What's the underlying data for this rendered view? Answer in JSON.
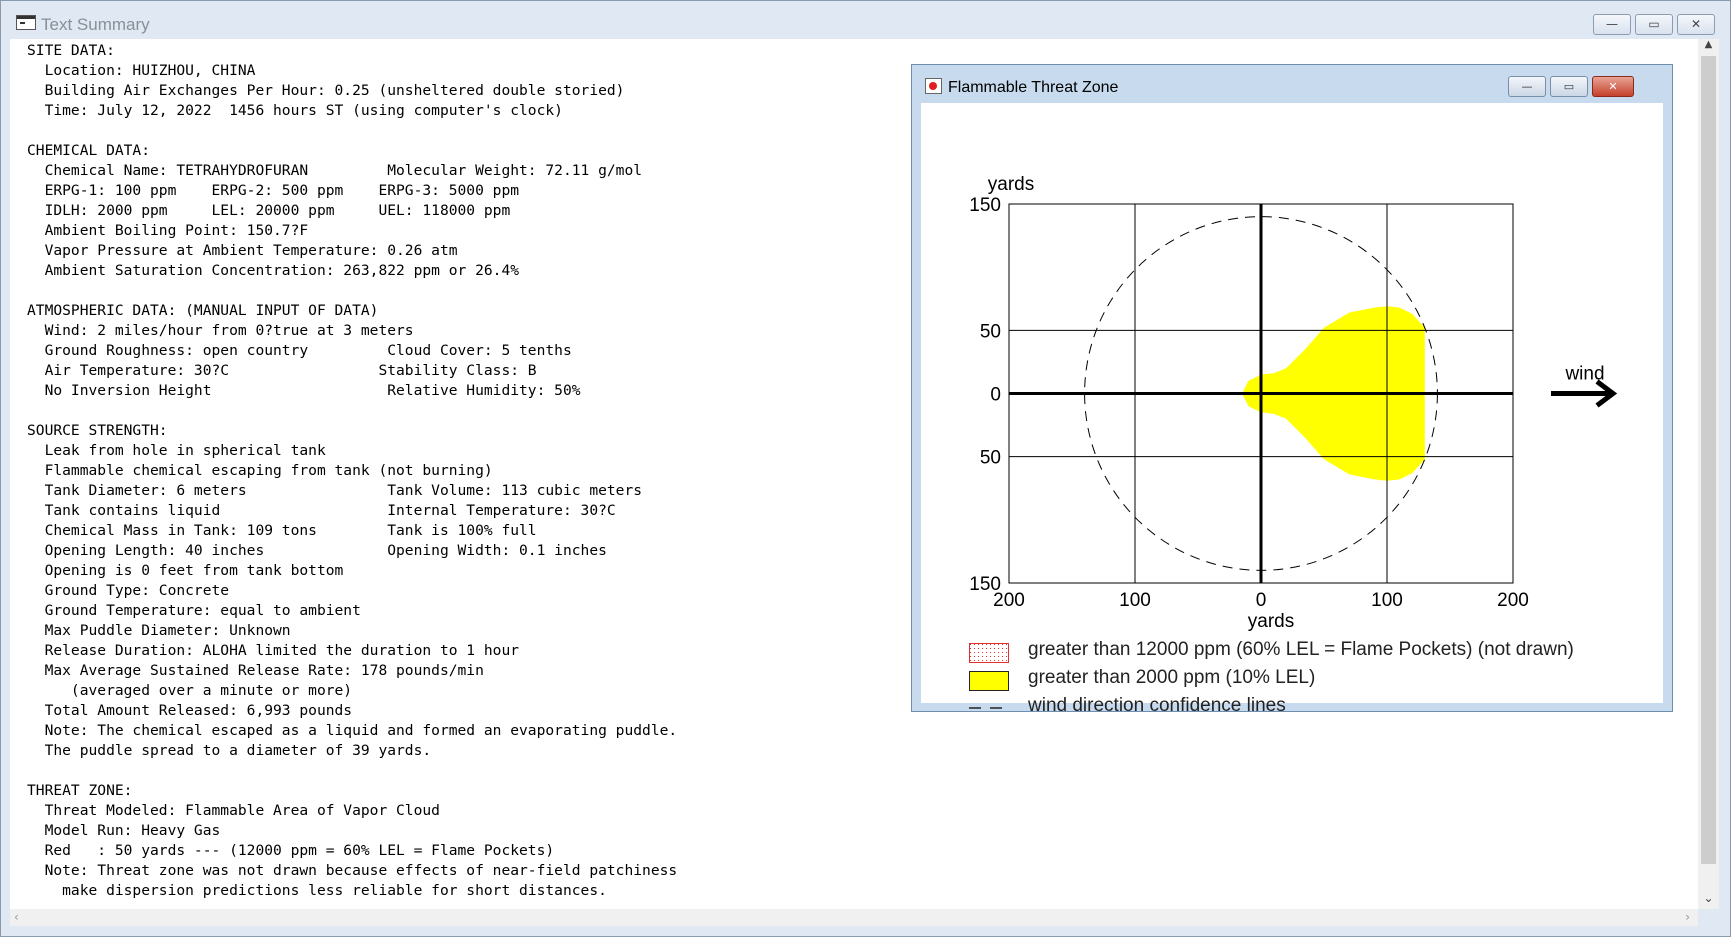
{
  "window": {
    "title": "Text Summary",
    "minimize": "—",
    "restore": "▭",
    "close": "✕"
  },
  "summary_lines": [
    "SITE DATA:",
    "  Location: HUIZHOU, CHINA",
    "  Building Air Exchanges Per Hour: 0.25 (unsheltered double storied)",
    "  Time: July 12, 2022  1456 hours ST (using computer's clock)",
    "",
    "CHEMICAL DATA:",
    "  Chemical Name: TETRAHYDROFURAN         Molecular Weight: 72.11 g/mol",
    "  ERPG-1: 100 ppm    ERPG-2: 500 ppm    ERPG-3: 5000 ppm",
    "  IDLH: 2000 ppm     LEL: 20000 ppm     UEL: 118000 ppm",
    "  Ambient Boiling Point: 150.7?F",
    "  Vapor Pressure at Ambient Temperature: 0.26 atm",
    "  Ambient Saturation Concentration: 263,822 ppm or 26.4%",
    "",
    "ATMOSPHERIC DATA: (MANUAL INPUT OF DATA)",
    "  Wind: 2 miles/hour from 0?true at 3 meters",
    "  Ground Roughness: open country         Cloud Cover: 5 tenths",
    "  Air Temperature: 30?C                 Stability Class: B",
    "  No Inversion Height                    Relative Humidity: 50%",
    "",
    "SOURCE STRENGTH:",
    "  Leak from hole in spherical tank",
    "  Flammable chemical escaping from tank (not burning)",
    "  Tank Diameter: 6 meters                Tank Volume: 113 cubic meters",
    "  Tank contains liquid                   Internal Temperature: 30?C",
    "  Chemical Mass in Tank: 109 tons        Tank is 100% full",
    "  Opening Length: 40 inches              Opening Width: 0.1 inches",
    "  Opening is 0 feet from tank bottom",
    "  Ground Type: Concrete",
    "  Ground Temperature: equal to ambient",
    "  Max Puddle Diameter: Unknown",
    "  Release Duration: ALOHA limited the duration to 1 hour",
    "  Max Average Sustained Release Rate: 178 pounds/min",
    "     (averaged over a minute or more)",
    "  Total Amount Released: 6,993 pounds",
    "  Note: The chemical escaped as a liquid and formed an evaporating puddle.",
    "  The puddle spread to a diameter of 39 yards.",
    "",
    "THREAT ZONE:",
    "  Threat Modeled: Flammable Area of Vapor Cloud",
    "  Model Run: Heavy Gas",
    "  Red   : 50 yards --- (12000 ppm = 60% LEL = Flame Pockets)",
    "  Note: Threat zone was not drawn because effects of near-field patchiness",
    "    make dispersion predictions less reliable for short distances."
  ],
  "threat_window": {
    "title": "Flammable Threat Zone",
    "minimize": "—",
    "restore": "▭",
    "close": "✕"
  },
  "plot": {
    "y_unit": "yards",
    "x_unit": "yards",
    "y_ticks": [
      "150",
      "50",
      "0",
      "50",
      "150"
    ],
    "x_ticks": [
      "200",
      "100",
      "0",
      "100",
      "200"
    ],
    "wind_label": "wind",
    "legend": [
      {
        "key": "red",
        "text": "greater than 12000 ppm (60% LEL = Flame Pockets) (not drawn)",
        "color": "#e03030"
      },
      {
        "key": "yellow",
        "text": "greater than 2000 ppm (10% LEL)",
        "color": "#ffff00"
      },
      {
        "key": "confidence",
        "text": "wind direction confidence lines",
        "color": "#000000"
      }
    ]
  },
  "chart_data": {
    "type": "area",
    "xlabel": "yards",
    "ylabel": "yards",
    "xlim": [
      -200,
      200
    ],
    "ylim": [
      -150,
      150
    ],
    "x_tick_values": [
      -200,
      -100,
      0,
      100,
      200
    ],
    "y_tick_values": [
      -150,
      -50,
      0,
      50,
      150
    ],
    "series": [
      {
        "name": "greater than 2000 ppm (10% LEL)",
        "color": "#ffff00",
        "x": [
          -15,
          -10,
          0,
          10,
          20,
          35,
          50,
          70,
          90,
          100,
          110,
          120,
          130,
          130,
          120,
          110,
          100,
          90,
          70,
          50,
          35,
          20,
          10,
          0,
          -10,
          -15
        ],
        "y": [
          0,
          10,
          15,
          16,
          20,
          35,
          52,
          64,
          68,
          69,
          68,
          63,
          52,
          -52,
          -63,
          -68,
          -69,
          -68,
          -64,
          -52,
          -35,
          -20,
          -16,
          -15,
          -10,
          0
        ]
      },
      {
        "name": "wind direction confidence lines",
        "type": "dashed-circle",
        "center_x": 0,
        "radius": 140
      }
    ],
    "annotations": [
      "wind"
    ]
  }
}
